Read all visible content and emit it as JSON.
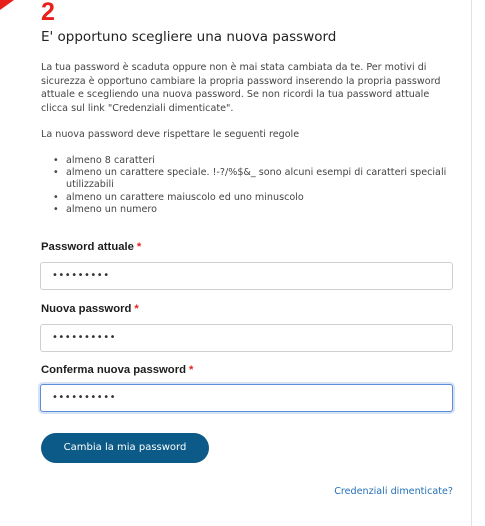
{
  "annotation": {
    "step_number": "2",
    "color": "#e8201a"
  },
  "form": {
    "title": "E' opportuno scegliere una nuova password",
    "intro": "La tua password è scaduta oppure non è mai stata cambiata da te. Per motivi di sicurezza è opportuno cambiare la propria password inserendo la propria password attuale e scegliendo una nuova password. Se non ricordi la tua password attuale clicca sul link \"Credenziali dimenticate\".",
    "rules_title": "La nuova password deve rispettare le seguenti regole",
    "rules": [
      "almeno 8 caratteri",
      "almeno un carattere speciale. !-?/%$&_ sono alcuni esempi di caratteri speciali utilizzabili",
      "almeno un carattere maiuscolo ed uno minuscolo",
      "almeno un numero"
    ],
    "required_marker": "*",
    "fields": {
      "current_password": {
        "label": "Password attuale",
        "value": "•••••••••"
      },
      "new_password": {
        "label": "Nuova password",
        "value": "••••••••••"
      },
      "confirm_password": {
        "label": "Conferma nuova password",
        "value": "••••••••••",
        "focused": true
      }
    },
    "submit_label": "Cambia la mia password",
    "forgot_link": "Credenziali dimenticate?"
  },
  "colors": {
    "accent": "#0c5a87",
    "link": "#2570b8",
    "required": "#e8201a",
    "focus": "#5b8ddb"
  }
}
